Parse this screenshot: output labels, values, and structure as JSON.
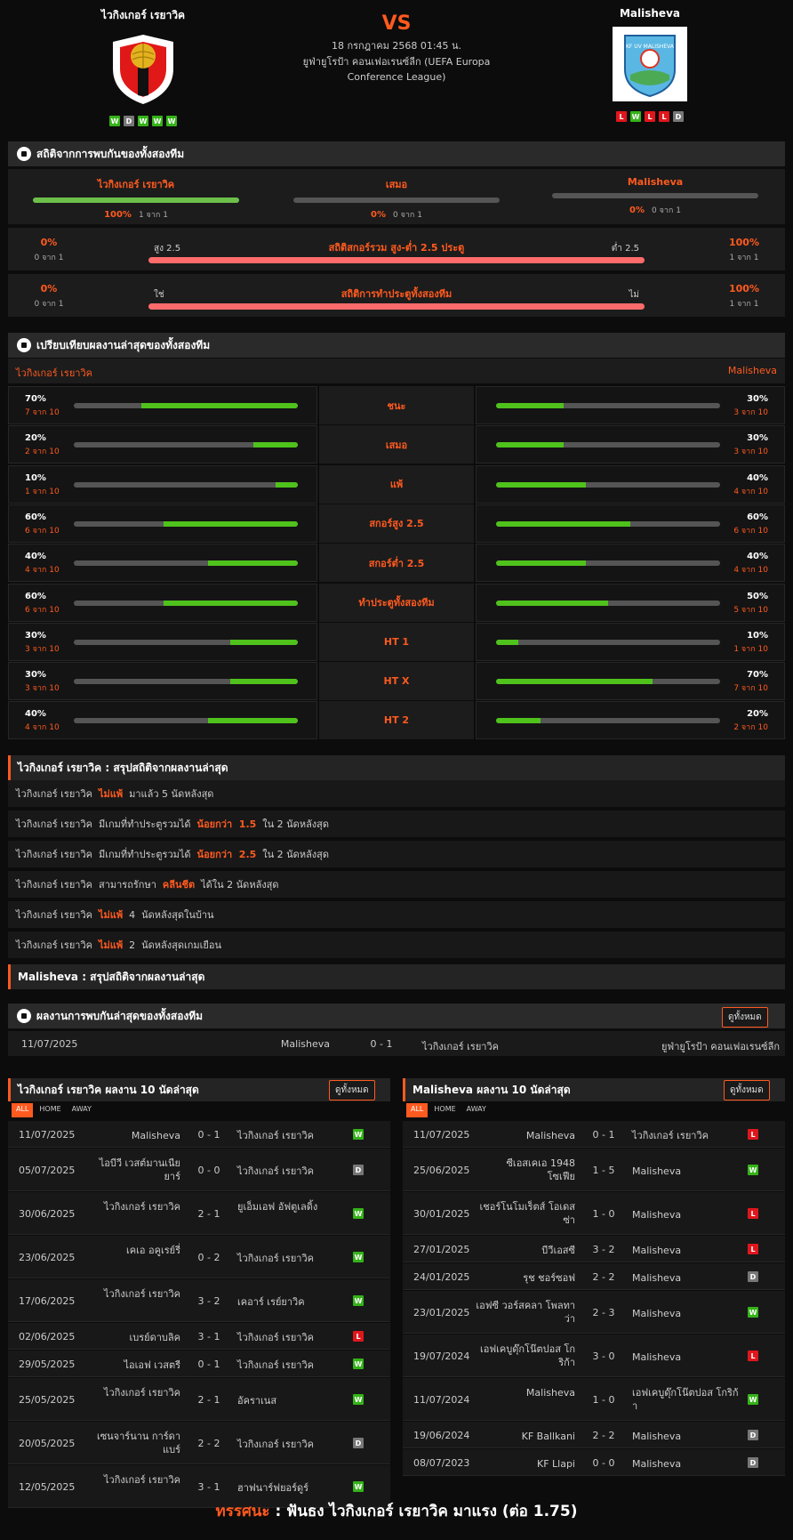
{
  "home": {
    "name": "ไวกิงเกอร์ เรยาวิค",
    "form": [
      "W",
      "D",
      "W",
      "W",
      "W"
    ]
  },
  "away": {
    "name": "Malisheva",
    "form": [
      "L",
      "W",
      "L",
      "L",
      "D"
    ],
    "crest_text": "KF UV MALISHEVA"
  },
  "match": {
    "vs": "VS",
    "date": "18 กรกฎาคม 2568 01:45 น.",
    "league": "ยูฟ่ายูโรป้า คอนเฟอเรนซ์ลีก (UEFA Europa Conference League)"
  },
  "h2h": {
    "title": "สถิติจากการพบกันของทั้งสองทีม",
    "home_label": "ไวกิงเกอร์ เรยาวิค",
    "draw_label": "เสมอ",
    "away_label": "Malisheva",
    "home_pct": "100%",
    "home_of": "1 จาก 1",
    "home_fill": 1,
    "draw_pct": "0%",
    "draw_of": "0 จาก 1",
    "draw_fill": 0,
    "away_pct": "0%",
    "away_of": "0 จาก 1",
    "away_fill": 0
  },
  "ou": {
    "title": "สถิติสกอร์รวม สูง-ต่ำ 2.5 ประตู",
    "left_label": "สูง 2.5",
    "right_label": "ต่ำ 2.5",
    "lp": "0%",
    "lof": "0 จาก 1",
    "rp": "100%",
    "rof": "1 จาก 1"
  },
  "btts": {
    "title": "สถิติการทำประตูทั้งสองทีม",
    "left_label": "ใช่",
    "right_label": "ไม่",
    "lp": "0%",
    "lof": "0 จาก 1",
    "rp": "100%",
    "rof": "1 จาก 1"
  },
  "compare": {
    "title": "เปรียบเทียบผลงานล่าสุดของทั้งสองทีม",
    "home": "ไวกิงเกอร์ เรยาวิค",
    "away": "Malisheva",
    "rows": [
      {
        "label": "ชนะ",
        "hp": "70%",
        "hof": "7 จาก 10",
        "hv": 0.7,
        "ap": "30%",
        "aof": "3 จาก 10",
        "av": 0.3
      },
      {
        "label": "เสมอ",
        "hp": "20%",
        "hof": "2 จาก 10",
        "hv": 0.2,
        "ap": "30%",
        "aof": "3 จาก 10",
        "av": 0.3
      },
      {
        "label": "แพ้",
        "hp": "10%",
        "hof": "1 จาก 10",
        "hv": 0.1,
        "ap": "40%",
        "aof": "4 จาก 10",
        "av": 0.4
      },
      {
        "label": "สกอร์สูง 2.5",
        "hp": "60%",
        "hof": "6 จาก 10",
        "hv": 0.6,
        "ap": "60%",
        "aof": "6 จาก 10",
        "av": 0.6
      },
      {
        "label": "สกอร์ต่ำ 2.5",
        "hp": "40%",
        "hof": "4 จาก 10",
        "hv": 0.4,
        "ap": "40%",
        "aof": "4 จาก 10",
        "av": 0.4
      },
      {
        "label": "ทำประตูทั้งสองทีม",
        "hp": "60%",
        "hof": "6 จาก 10",
        "hv": 0.6,
        "ap": "50%",
        "aof": "5 จาก 10",
        "av": 0.5
      },
      {
        "label": "HT 1",
        "hp": "30%",
        "hof": "3 จาก 10",
        "hv": 0.3,
        "ap": "10%",
        "aof": "1 จาก 10",
        "av": 0.1
      },
      {
        "label": "HT X",
        "hp": "30%",
        "hof": "3 จาก 10",
        "hv": 0.3,
        "ap": "70%",
        "aof": "7 จาก 10",
        "av": 0.7
      },
      {
        "label": "HT 2",
        "hp": "40%",
        "hof": "4 จาก 10",
        "hv": 0.4,
        "ap": "20%",
        "aof": "2 จาก 10",
        "av": 0.2
      }
    ]
  },
  "summary_home": {
    "title": "ไวกิงเกอร์ เรยาวิค : สรุปสถิติจากผลงานล่าสุด",
    "rows": [
      {
        "pre": "ไวกิงเกอร์ เรยาวิค  ",
        "hl": "ไม่แพ้",
        "post": "  มาแล้ว 5 นัดหลังสุด"
      },
      {
        "pre": "ไวกิงเกอร์ เรยาวิค  มีเกมที่ทำประตูรวมได้  ",
        "hl": "น้อยกว่า  1.5",
        "post": "  ใน 2 นัดหลังสุด"
      },
      {
        "pre": "ไวกิงเกอร์ เรยาวิค  มีเกมที่ทำประตูรวมได้  ",
        "hl": "น้อยกว่า  2.5",
        "post": "  ใน 2 นัดหลังสุด"
      },
      {
        "pre": "ไวกิงเกอร์ เรยาวิค  สามารถรักษา  ",
        "hl": "คลีนชีต",
        "post": "  ได้ใน 2 นัดหลังสุด"
      },
      {
        "pre": "ไวกิงเกอร์ เรยาวิค  ",
        "hl": "ไม่แพ้",
        "post": "  4  นัดหลังสุดในบ้าน"
      },
      {
        "pre": "ไวกิงเกอร์ เรยาวิค  ",
        "hl": "ไม่แพ้",
        "post": "  2  นัดหลังสุดเกมเยือน"
      }
    ]
  },
  "summary_away": {
    "title": "Malisheva : สรุปสถิติจากผลงานล่าสุด"
  },
  "recent_h2h": {
    "title": "ผลงานการพบกันล่าสุดของทั้งสองทีม",
    "btn": "ดูทั้งหมด",
    "date": "11/07/2025",
    "home": "Malisheva",
    "score": "0 - 1",
    "away": "ไวกิงเกอร์ เรยาวิค",
    "league": "ยูฟ่ายูโรป้า คอนเฟอเรนซ์ลีก"
  },
  "tabs": [
    "ALL",
    "HOME",
    "AWAY"
  ],
  "last_home": {
    "title": "ไวกิงเกอร์ เรยาวิค ผลงาน 10 นัดล่าสุด",
    "btn": "ดูทั้งหมด",
    "rows": [
      {
        "d": "11/07/2025",
        "h": "Malisheva",
        "s": "0 - 1",
        "a": "ไวกิงเกอร์ เรยาวิค",
        "r": "W"
      },
      {
        "d": "05/07/2025",
        "h": "ไอบีวี เวสต์มานเนีย ยาร์",
        "s": "0 - 0",
        "a": "ไวกิงเกอร์ เรยาวิค",
        "r": "D"
      },
      {
        "d": "30/06/2025",
        "h": "ไวกิงเกอร์ เรยาวิค",
        "s": "2 - 1",
        "a": "ยูเอ็มเอฟ อัฟตูเลดิ้ง",
        "r": "W"
      },
      {
        "d": "23/06/2025",
        "h": "เคเอ อคูเรย์รี่",
        "s": "0 - 2",
        "a": "ไวกิงเกอร์ เรยาวิค",
        "r": "W"
      },
      {
        "d": "17/06/2025",
        "h": "ไวกิงเกอร์ เรยาวิค",
        "s": "3 - 2",
        "a": "เคอาร์ เรย์ยาวิค",
        "r": "W"
      },
      {
        "d": "02/06/2025",
        "h": "เบรย์ดาบลิค",
        "s": "3 - 1",
        "a": "ไวกิงเกอร์ เรยาวิค",
        "r": "L"
      },
      {
        "d": "29/05/2025",
        "h": "ไอเอฟ เวสตรี",
        "s": "0 - 1",
        "a": "ไวกิงเกอร์ เรยาวิค",
        "r": "W"
      },
      {
        "d": "25/05/2025",
        "h": "ไวกิงเกอร์ เรยาวิค",
        "s": "2 - 1",
        "a": "อัคราเนส",
        "r": "W"
      },
      {
        "d": "20/05/2025",
        "h": "เซนจาร์นาน การ์ดา แบร์",
        "s": "2 - 2",
        "a": "ไวกิงเกอร์ เรยาวิค",
        "r": "D"
      },
      {
        "d": "12/05/2025",
        "h": "ไวกิงเกอร์ เรยาวิค",
        "s": "3 - 1",
        "a": "ฮาฟนาร์ฟยอร์ดูร์",
        "r": "W"
      }
    ]
  },
  "last_away": {
    "title": "Malisheva ผลงาน 10 นัดล่าสุด",
    "btn": "ดูทั้งหมด",
    "rows": [
      {
        "d": "11/07/2025",
        "h": "Malisheva",
        "s": "0 - 1",
        "a": "ไวกิงเกอร์ เรยาวิค",
        "r": "L"
      },
      {
        "d": "25/06/2025",
        "h": "ซีเอสเคเอ 1948 โซเฟีย",
        "s": "1 - 5",
        "a": "Malisheva",
        "r": "W"
      },
      {
        "d": "30/01/2025",
        "h": "เชอร์โนโมเร็ตส์ โอเดสซ่า",
        "s": "1 - 0",
        "a": "Malisheva",
        "r": "L"
      },
      {
        "d": "27/01/2025",
        "h": "บีวีเอสซี",
        "s": "3 - 2",
        "a": "Malisheva",
        "r": "L"
      },
      {
        "d": "24/01/2025",
        "h": "รุช ชอร์ซอฟ",
        "s": "2 - 2",
        "a": "Malisheva",
        "r": "D"
      },
      {
        "d": "23/01/2025",
        "h": "เอฟซี วอร์สคลา โพลทาว่า",
        "s": "2 - 3",
        "a": "Malisheva",
        "r": "W"
      },
      {
        "d": "19/07/2024",
        "h": "เอฟเคบูดุ๊กโน๊ตปอส โกริก้า",
        "s": "3 - 0",
        "a": "Malisheva",
        "r": "L"
      },
      {
        "d": "11/07/2024",
        "h": "Malisheva",
        "s": "1 - 0",
        "a": "เอฟเคบูดุ๊กโน๊ตปอส โกริก้า",
        "r": "W"
      },
      {
        "d": "19/06/2024",
        "h": "KF Ballkani",
        "s": "2 - 2",
        "a": "Malisheva",
        "r": "D"
      },
      {
        "d": "08/07/2023",
        "h": "KF Llapi",
        "s": "0 - 0",
        "a": "Malisheva",
        "r": "D"
      }
    ]
  },
  "tip": {
    "label": "ทรรศนะ",
    "sep": " :  ",
    "text": "ฟันธง ไวกิงเกอร์ เรยาวิค มาแรง (ต่อ 1.75)"
  }
}
